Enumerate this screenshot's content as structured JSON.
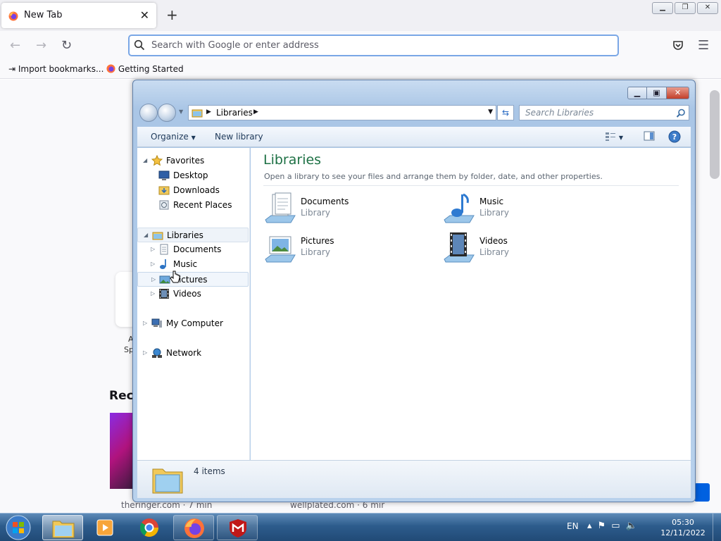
{
  "browser": {
    "tab_title": "New Tab",
    "url_placeholder": "Search with Google or enter address",
    "bookmarks": [
      "Import bookmarks...",
      "Getting Started"
    ],
    "page": {
      "recent_label": "Reco",
      "stories": [
        "theringer.com · 7 min",
        "wellplated.com · 6 mir"
      ],
      "card_fragments": [
        "A",
        "Sp"
      ]
    }
  },
  "explorer": {
    "breadcrumb": [
      "Libraries"
    ],
    "search_placeholder": "Search Libraries",
    "commands": {
      "organize": "Organize",
      "new_library": "New library"
    },
    "nav": {
      "favorites": {
        "label": "Favorites",
        "items": [
          "Desktop",
          "Downloads",
          "Recent Places"
        ]
      },
      "libraries": {
        "label": "Libraries",
        "items": [
          "Documents",
          "Music",
          "Pictures",
          "Videos"
        ]
      },
      "my_computer": "My Computer",
      "network": "Network"
    },
    "main": {
      "title": "Libraries",
      "description": "Open a library to see your files and arrange them by folder, date, and other properties.",
      "libraries": [
        {
          "name": "Documents",
          "type": "Library",
          "icon": "documents-library-icon"
        },
        {
          "name": "Music",
          "type": "Library",
          "icon": "music-library-icon"
        },
        {
          "name": "Pictures",
          "type": "Library",
          "icon": "pictures-library-icon"
        },
        {
          "name": "Videos",
          "type": "Library",
          "icon": "videos-library-icon"
        }
      ]
    },
    "status": {
      "count": "4 items"
    }
  },
  "taskbar": {
    "language": "EN",
    "time": "05:30",
    "date": "12/11/2022"
  },
  "colors": {
    "explorer_title_green": "#1e7145",
    "taskbar_blue": "#2d5c8c",
    "url_focus": "#7aa7e6"
  }
}
